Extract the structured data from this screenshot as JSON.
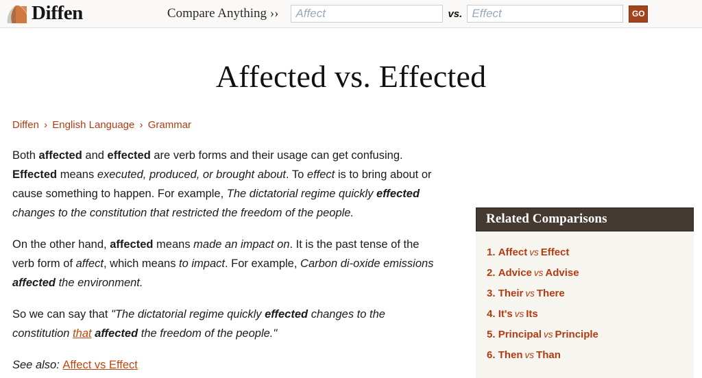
{
  "header": {
    "logo_text": "Diffen",
    "logo_icon": "diffen-fan-logo-icon",
    "compare_link": "Compare Anything ››",
    "search": {
      "term_a_placeholder": "Affect",
      "term_b_placeholder": "Effect",
      "term_a_value": "",
      "term_b_value": "",
      "vs_label": "vs.",
      "go_label": "GO"
    }
  },
  "page": {
    "title": "Affected vs. Effected"
  },
  "breadcrumb": {
    "separator": "›",
    "items": [
      {
        "label": "Diffen"
      },
      {
        "label": "English Language"
      },
      {
        "label": "Grammar"
      }
    ]
  },
  "article": {
    "paragraph_1": {
      "t1": "Both ",
      "b1": "affected",
      "t2": " and ",
      "b2": "effected",
      "t3": " are verb forms and their usage can get confusing. ",
      "b3": "Effected",
      "t4": " means ",
      "i1": "executed, produced, or brought about",
      "t5": ". To ",
      "i2": "effect",
      "t6": " is to bring about or cause something to happen. For example, ",
      "i3": "The dictatorial regime quickly ",
      "ib1": "effected",
      "i4": " changes to the constitution that restricted the freedom of the people."
    },
    "paragraph_2": {
      "t1": "On the other hand, ",
      "b1": "affected",
      "t2": " means ",
      "i1": "made an impact on",
      "t3": ". It is the past tense of the verb form of ",
      "i2": "affect",
      "t4": ", which means ",
      "i3": "to impact",
      "t5": ". For example, ",
      "i4": "Carbon di-oxide emissions ",
      "ib1": "affected",
      "i5": " the environment."
    },
    "paragraph_3": {
      "t1": "So we can say that ",
      "i1": "\"The dictatorial regime quickly ",
      "ib1": "effected",
      "i2": " changes to the constitution ",
      "link1": "that",
      "i3": " ",
      "ib2": "affected",
      "i4": " the freedom of the people.\""
    },
    "see_also": {
      "label": "See also: ",
      "link": "Affect vs Effect"
    }
  },
  "related": {
    "header": "Related Comparisons",
    "vs_label": "vs",
    "items": [
      {
        "number": "1.",
        "left": "Affect",
        "right": "Effect"
      },
      {
        "number": "2.",
        "left": "Advice",
        "right": "Advise"
      },
      {
        "number": "3.",
        "left": "Their",
        "right": "There"
      },
      {
        "number": "4.",
        "left": "It's",
        "right": "Its"
      },
      {
        "number": "5.",
        "left": "Principal",
        "right": "Principle"
      },
      {
        "number": "6.",
        "left": "Then",
        "right": "Than"
      }
    ]
  },
  "colors": {
    "accent_link": "#b23c12",
    "accent_inline_link": "#c0460f",
    "go_button": "#a4441c",
    "related_header_bg": "#443a32",
    "related_panel_bg": "#f7f5f0",
    "header_bg": "#faf9f7"
  }
}
